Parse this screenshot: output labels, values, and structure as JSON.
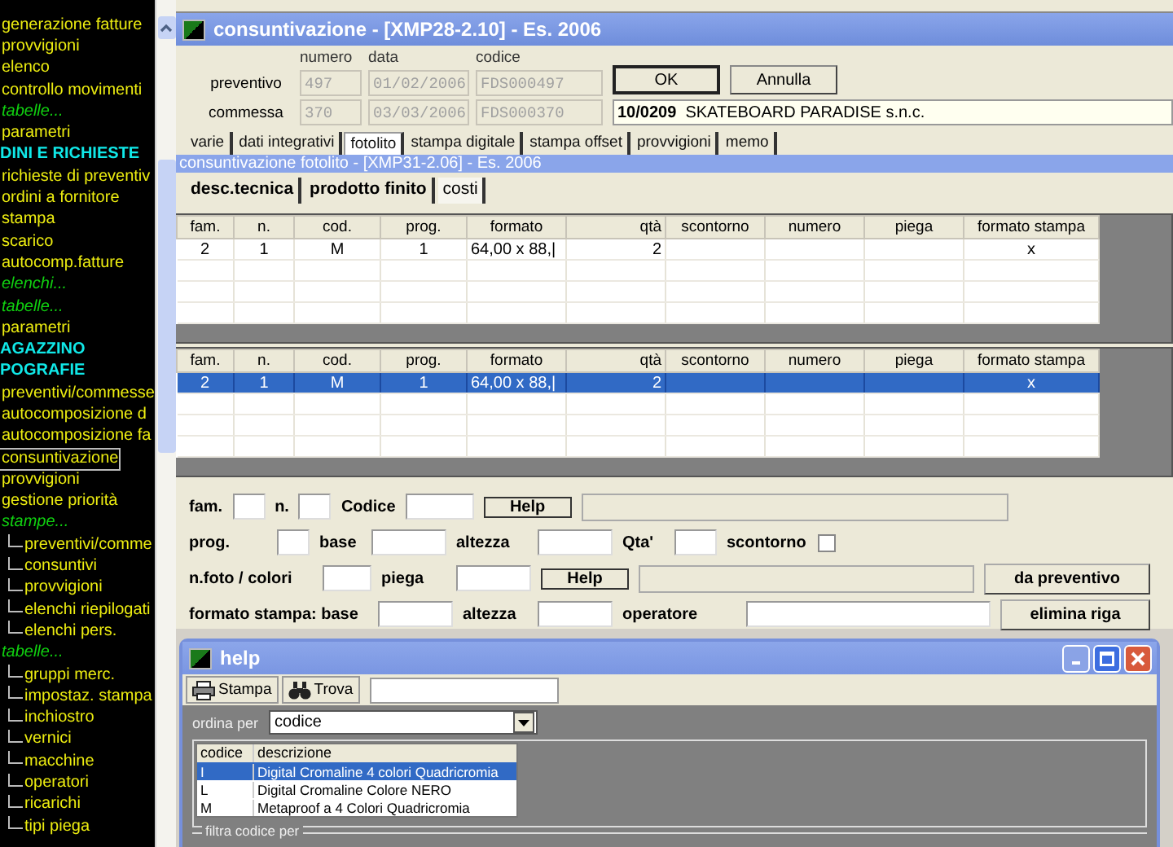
{
  "sidebar": {
    "items": [
      {
        "text": "generazione fatture",
        "kind": "item",
        "selected": false
      },
      {
        "text": "provvigioni",
        "kind": "item",
        "selected": false
      },
      {
        "text": "elenco",
        "kind": "item",
        "selected": false
      },
      {
        "text": "controllo movimenti",
        "kind": "item",
        "selected": false
      },
      {
        "text": "tabelle...",
        "kind": "category",
        "selected": false
      },
      {
        "text": "parametri",
        "kind": "item",
        "selected": false
      },
      {
        "text": "DINI E RICHIESTE",
        "kind": "section",
        "selected": false
      },
      {
        "text": "richieste di preventiv",
        "kind": "item",
        "selected": false
      },
      {
        "text": "ordini a fornitore",
        "kind": "item",
        "selected": false
      },
      {
        "text": "stampa",
        "kind": "item",
        "selected": false
      },
      {
        "text": "scarico",
        "kind": "item",
        "selected": false
      },
      {
        "text": "autocomp.fatture",
        "kind": "item",
        "selected": false
      },
      {
        "text": "elenchi...",
        "kind": "category",
        "selected": false
      },
      {
        "text": "tabelle...",
        "kind": "category",
        "selected": false
      },
      {
        "text": "parametri",
        "kind": "item",
        "selected": false
      },
      {
        "text": "AGAZZINO",
        "kind": "section",
        "selected": false
      },
      {
        "text": "POGRAFIE",
        "kind": "section",
        "selected": false
      },
      {
        "text": "preventivi/commesse",
        "kind": "item",
        "selected": false
      },
      {
        "text": "autocomposizione d",
        "kind": "item",
        "selected": false
      },
      {
        "text": "autocomposizione fa",
        "kind": "item",
        "selected": false
      },
      {
        "text": "consuntivazione",
        "kind": "item",
        "selected": true
      },
      {
        "text": "provvigioni",
        "kind": "item",
        "selected": false
      },
      {
        "text": "gestione priorità",
        "kind": "item",
        "selected": false
      },
      {
        "text": "stampe...",
        "kind": "category",
        "selected": false
      },
      {
        "text": "preventivi/comme",
        "kind": "subitem",
        "selected": false
      },
      {
        "text": "consuntivi",
        "kind": "subitem",
        "selected": false
      },
      {
        "text": "provvigioni",
        "kind": "subitem",
        "selected": false
      },
      {
        "text": "elenchi riepilogati",
        "kind": "subitem",
        "selected": false
      },
      {
        "text": "elenchi pers.",
        "kind": "subitem",
        "selected": false
      },
      {
        "text": "tabelle...",
        "kind": "category",
        "selected": false
      },
      {
        "text": "gruppi merc.",
        "kind": "subitem",
        "selected": false
      },
      {
        "text": "impostaz. stampa",
        "kind": "subitem",
        "selected": false
      },
      {
        "text": "inchiostro",
        "kind": "subitem",
        "selected": false
      },
      {
        "text": "vernici",
        "kind": "subitem",
        "selected": false
      },
      {
        "text": "macchine",
        "kind": "subitem",
        "selected": false
      },
      {
        "text": "operatori",
        "kind": "subitem",
        "selected": false
      },
      {
        "text": "ricarichi",
        "kind": "subitem",
        "selected": false
      },
      {
        "text": "tipi piega",
        "kind": "subitem",
        "selected": false
      }
    ]
  },
  "main_window": {
    "title": "consuntivazione - [XMP28-2.10] - Es. 2006",
    "column_labels": [
      "numero",
      "data",
      "codice"
    ],
    "rows": [
      {
        "label": "preventivo",
        "values": [
          "497",
          "01/02/2006",
          "FDS000497"
        ]
      },
      {
        "label": "commessa",
        "values": [
          "370",
          "03/03/2006",
          "FDS000370"
        ]
      }
    ],
    "buttons": [
      "OK",
      "Annulla"
    ],
    "client": "**10/0209**  SKATEBOARD PARADISE s.n.c.",
    "tabs": [
      {
        "label": "varie",
        "selected": false
      },
      {
        "label": "dati integrativi",
        "selected": false
      },
      {
        "label": "fotolito",
        "selected": true
      },
      {
        "label": "stampa digitale",
        "selected": false
      },
      {
        "label": "stampa offset",
        "selected": false
      },
      {
        "label": "provvigioni",
        "selected": false
      },
      {
        "label": "memo",
        "selected": false
      }
    ]
  },
  "sub_window": {
    "title": "consuntivazione fotolito - [XMP31-2.06] - Es. 2006",
    "tabs": [
      {
        "label": "desc.tecnica",
        "selected": false
      },
      {
        "label": "prodotto finito",
        "selected": false
      },
      {
        "label": "costi",
        "selected": true
      }
    ],
    "tables": [
      {
        "columns": [
          "fam.",
          "n.",
          "cod.",
          "prog.",
          "formato",
          "qtà",
          "scontorno",
          "numero",
          "piega",
          "formato stampa"
        ],
        "rows": [
          {
            "cells": [
              "2",
              "1",
              "M",
              "1",
              "64,00 x 88,|",
              "2",
              "",
              "",
              "",
              "x"
            ],
            "selected": false
          }
        ]
      },
      {
        "columns": [
          "fam.",
          "n.",
          "cod.",
          "prog.",
          "formato",
          "qtà",
          "scontorno",
          "numero",
          "piega",
          "formato stampa"
        ],
        "rows": [
          {
            "cells": [
              "2",
              "1",
              "M",
              "1",
              "64,00 x 88,|",
              "2",
              "",
              "",
              "",
              "x"
            ],
            "selected": true
          }
        ]
      }
    ],
    "form": [
      [
        {
          "kind": "label",
          "text": "fam."
        },
        {
          "kind": "input"
        },
        {
          "kind": "label",
          "text": "n."
        },
        {
          "kind": "input"
        },
        {
          "kind": "label",
          "text": "Codice"
        },
        {
          "kind": "input"
        },
        {
          "kind": "button",
          "text": "Help"
        },
        {
          "kind": "display"
        }
      ],
      [
        {
          "kind": "label",
          "text": "prog."
        },
        {
          "kind": "input"
        },
        {
          "kind": "label",
          "text": "base"
        },
        {
          "kind": "input"
        },
        {
          "kind": "label",
          "text": "altezza"
        },
        {
          "kind": "input"
        },
        {
          "kind": "label",
          "text": "Qta'"
        },
        {
          "kind": "input"
        },
        {
          "kind": "label",
          "text": "scontorno"
        },
        {
          "kind": "checkbox",
          "checked": false
        }
      ],
      [
        {
          "kind": "label",
          "text": "n.foto / colori"
        },
        {
          "kind": "input"
        },
        {
          "kind": "label",
          "text": "piega"
        },
        {
          "kind": "input"
        },
        {
          "kind": "button",
          "text": "Help"
        },
        {
          "kind": "display"
        },
        {
          "kind": "bigbutton",
          "text": "da preventivo"
        }
      ],
      [
        {
          "kind": "label",
          "text": "formato stampa: base"
        },
        {
          "kind": "input"
        },
        {
          "kind": "label",
          "text": "altezza"
        },
        {
          "kind": "input"
        },
        {
          "kind": "label",
          "text": "operatore"
        },
        {
          "kind": "input"
        },
        {
          "kind": "bigbutton",
          "text": "elimina riga"
        }
      ]
    ]
  },
  "help_window": {
    "title": "help",
    "toolbar": [
      {
        "kind": "print",
        "label": "Stampa"
      },
      {
        "kind": "find",
        "label": "Trova"
      }
    ],
    "sort_label": "ordina per",
    "sort_value": "codice",
    "list": {
      "columns": [
        "codice",
        "descrizione"
      ],
      "rows": [
        {
          "cells": [
            "I",
            "Digital Cromaline 4 colori Quadricromia"
          ],
          "selected": true
        },
        {
          "cells": [
            "L",
            "Digital Cromaline Colore NERO"
          ],
          "selected": false
        },
        {
          "cells": [
            "M",
            "Metaproof a 4 Colori Quadricromia"
          ],
          "selected": false
        }
      ]
    },
    "filter_label": "filtra codice per"
  }
}
